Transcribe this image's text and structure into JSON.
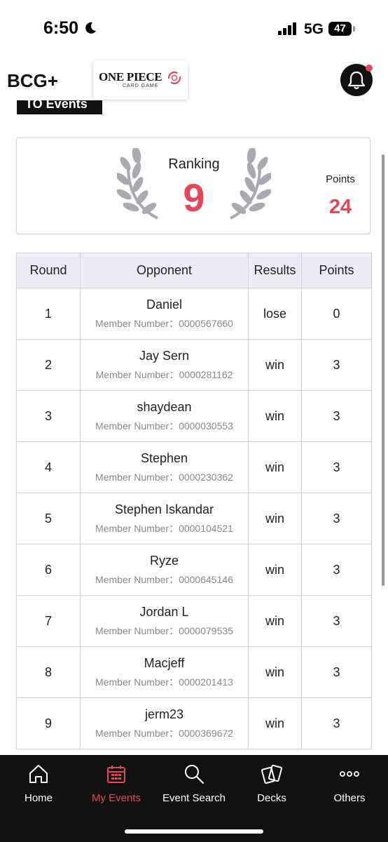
{
  "status_bar": {
    "time": "6:50",
    "network": "5G",
    "battery": "47"
  },
  "header": {
    "bcg_logo": "BCG+",
    "op_logo_title": "ONE PIECE",
    "op_logo_sub": "CARD GAME"
  },
  "section": {
    "label": "TO Events"
  },
  "summary": {
    "ranking_label": "Ranking",
    "ranking_value": "9",
    "points_label": "Points",
    "points_value": "24"
  },
  "table": {
    "headers": [
      "Round",
      "Opponent",
      "Results",
      "Points"
    ],
    "rows": [
      {
        "round": "1",
        "name": "Daniel",
        "member": "Member Number：0000567660",
        "result": "lose",
        "points": "0"
      },
      {
        "round": "2",
        "name": "Jay Sern",
        "member": "Member Number：0000281162",
        "result": "win",
        "points": "3"
      },
      {
        "round": "3",
        "name": "shaydean",
        "member": "Member Number：0000030553",
        "result": "win",
        "points": "3"
      },
      {
        "round": "4",
        "name": "Stephen",
        "member": "Member Number：0000230362",
        "result": "win",
        "points": "3"
      },
      {
        "round": "5",
        "name": "Stephen Iskandar",
        "member": "Member Number：0000104521",
        "result": "win",
        "points": "3"
      },
      {
        "round": "6",
        "name": "Ryze",
        "member": "Member Number：0000645146",
        "result": "win",
        "points": "3"
      },
      {
        "round": "7",
        "name": "Jordan L",
        "member": "Member Number：0000079535",
        "result": "win",
        "points": "3"
      },
      {
        "round": "8",
        "name": "Macjeff",
        "member": "Member Number：0000201413",
        "result": "win",
        "points": "3"
      },
      {
        "round": "9",
        "name": "jerm23",
        "member": "Member Number：0000369672",
        "result": "win",
        "points": "3"
      }
    ]
  },
  "nav": {
    "items": [
      {
        "label": "Home",
        "icon": "home-icon"
      },
      {
        "label": "My Events",
        "icon": "calendar-icon",
        "active": true
      },
      {
        "label": "Event Search",
        "icon": "search-icon"
      },
      {
        "label": "Decks",
        "icon": "cards-icon"
      },
      {
        "label": "Others",
        "icon": "more-icon"
      }
    ]
  },
  "colors": {
    "accent": "#e4475a",
    "nav_bg": "#111111",
    "header_cell": "#ececf4",
    "border": "#cfcfd6"
  }
}
